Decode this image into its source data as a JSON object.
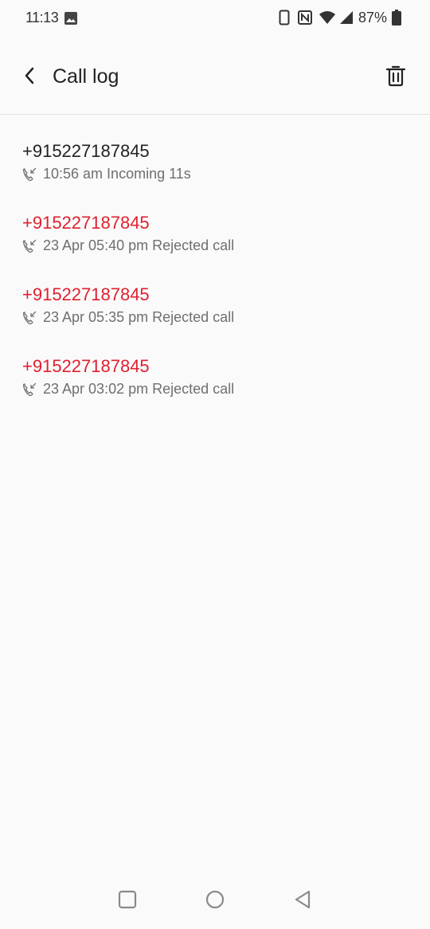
{
  "status_bar": {
    "time": "11:13",
    "battery": "87%",
    "icons": [
      "gallery-icon",
      "phone-icon",
      "nfc-icon",
      "wifi-icon",
      "signal-icon",
      "battery-icon"
    ]
  },
  "header": {
    "title": "Call log",
    "back_icon": "chevron-left-icon",
    "delete_icon": "trash-icon"
  },
  "calls": [
    {
      "number": "+915227187845",
      "detail": "10:56 am Incoming 11s",
      "missed": false
    },
    {
      "number": "+915227187845",
      "detail": "23 Apr 05:40 pm Rejected call",
      "missed": true
    },
    {
      "number": "+915227187845",
      "detail": "23 Apr 05:35 pm Rejected call",
      "missed": true
    },
    {
      "number": "+915227187845",
      "detail": "23 Apr 03:02 pm Rejected call",
      "missed": true
    }
  ],
  "colors": {
    "missed": "#e0202f",
    "normal": "#222222",
    "secondary": "#6f6f6f"
  },
  "nav_bar": {
    "icons": [
      "recents-square-icon",
      "home-circle-icon",
      "back-triangle-icon"
    ]
  }
}
